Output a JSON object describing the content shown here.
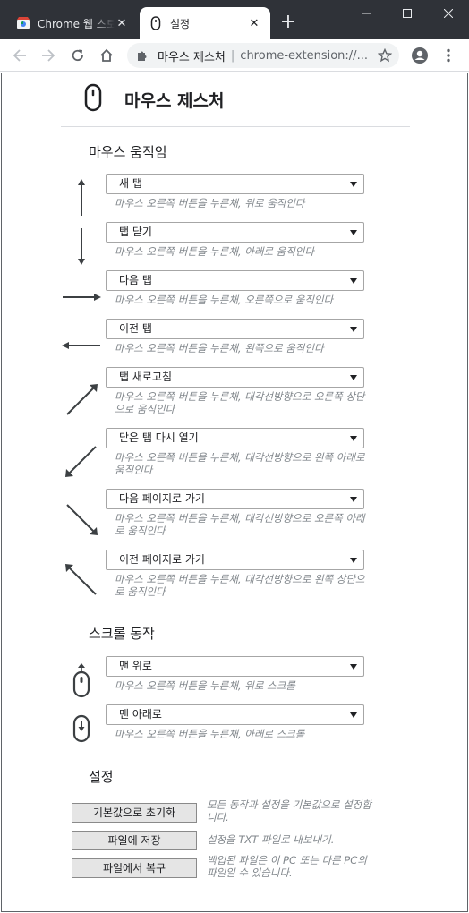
{
  "browser": {
    "tabs": [
      {
        "title": "Chrome 웹 스토어",
        "active": false
      },
      {
        "title": "설정",
        "active": true
      }
    ],
    "new_tab": "+",
    "omnibox": {
      "site": "마우스 제스처",
      "separator": "|",
      "url": "chrome-extension://..."
    }
  },
  "page": {
    "title": "마우스 제스처",
    "sections": {
      "movement": "마우스 움직임",
      "scroll": "스크롤 동작",
      "settings": "설정"
    },
    "gestures": [
      {
        "value": "새 탭",
        "desc": "마우스 오른쪽 버튼을 누른채, 위로 움직인다"
      },
      {
        "value": "탭 닫기",
        "desc": "마우스 오른쪽 버튼을 누른채, 아래로 움직인다"
      },
      {
        "value": "다음 탭",
        "desc": "마우스 오른쪽 버튼을 누른채, 오른쪽으로 움직인다"
      },
      {
        "value": "이전 탭",
        "desc": "마우스 오른쪽 버튼을 누른채, 왼쪽으로 움직인다"
      },
      {
        "value": "탭 새로고침",
        "desc": "마우스 오른쪽 버튼을 누른채, 대각선방향으로 오른쪽 상단으로 움직인다"
      },
      {
        "value": "닫은 탭 다시 열기",
        "desc": "마우스 오른쪽 버튼을 누른채, 대각선방향으로 왼쪽 아래로 움직인다"
      },
      {
        "value": "다음 페이지로 가기",
        "desc": "마우스 오른쪽 버튼을 누른채, 대각선방향으로 오른쪽 아래로 움직인다"
      },
      {
        "value": "이전 페이지로 가기",
        "desc": "마우스 오른쪽 버튼을 누른채, 대각선방향으로 왼쪽 상단으로 움직인다"
      }
    ],
    "scroll_actions": [
      {
        "value": "맨 위로",
        "desc": "마우스 오른쪽 버튼을 누른채, 위로 스크롤"
      },
      {
        "value": "맨 아래로",
        "desc": "마우스 오른쪽 버튼을 누른채, 아래로 스크롤"
      }
    ],
    "settings": [
      {
        "label": "기본값으로 초기화",
        "note": "모든 동작과 설정을 기본값으로 설정합니다."
      },
      {
        "label": "파일에 저장",
        "note": "설정을 TXT 파일로 내보내기."
      },
      {
        "label": "파일에서 복구",
        "note": "백업된 파일은 이 PC 또는 다른 PC의 파일일 수 있습니다."
      }
    ]
  },
  "icons": {
    "tab1": "web-store-icon",
    "tab2": "mouse-icon",
    "back": "back-arrow-icon",
    "forward": "forward-arrow-icon",
    "reload": "reload-icon",
    "home": "home-icon",
    "extension": "puzzle-icon",
    "star": "star-icon",
    "profile": "account-icon",
    "menu": "kebab-menu-icon"
  },
  "colors": {
    "titlebar": "#2f3238",
    "text": "#202124",
    "muted": "#80868b",
    "button": "#e5e5e5"
  }
}
